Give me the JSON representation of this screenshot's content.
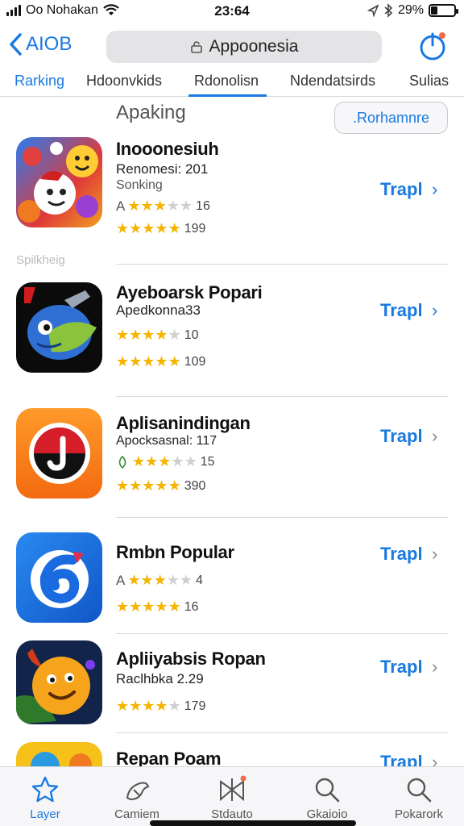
{
  "status": {
    "carrier": "Oo Nohakan",
    "time": "23:64",
    "battery_pct": "29%",
    "battery_level": 0.29
  },
  "nav": {
    "back_label": "AIOB",
    "search_text": "Appoonesia"
  },
  "tabs": [
    {
      "label": "Rarking"
    },
    {
      "label": "Hdoonvkids"
    },
    {
      "label": "Rdonolisn"
    },
    {
      "label": "Ndendatsirds"
    },
    {
      "label": "Sulias"
    }
  ],
  "section": {
    "title": "Apaking",
    "button": ".Rorhamnre",
    "side_label": "Spilkheig"
  },
  "apps": [
    {
      "name": "Inooonesiuh",
      "sub": "Renomesi: 201",
      "sub2": "Sonking",
      "r1_prefix": "A",
      "r1_stars": 3,
      "r1_count": "16",
      "r2_stars": 5,
      "r2_count": "199",
      "get": "Trapl",
      "icon": "emoji-ball-icon"
    },
    {
      "name": "Ayeboarsk Popari",
      "sub": "Apedkonna33",
      "r1_prefix": "",
      "r1_stars": 4,
      "r1_count": "10",
      "r2_stars": 5,
      "r2_count": "109",
      "get": "Trapl",
      "icon": "blue-bird-icon"
    },
    {
      "name": "Aplisanindingan",
      "sub": "Apocksasnal: 117",
      "r1_prefix": "leaf",
      "r1_stars": 3,
      "r1_count": "15",
      "r2_stars": 5,
      "r2_count": "390",
      "get": "Trapl",
      "icon": "red-j-icon"
    },
    {
      "name": "Rmbn Popular",
      "r1_prefix": "A",
      "r1_stars": 3,
      "r1_count": "4",
      "r2_stars": 5,
      "r2_count": "16",
      "get": "Trapl",
      "icon": "blue-swirl-icon"
    },
    {
      "name": "Apliiyabsis Ropan",
      "sub": "Raclhbka 2.29",
      "r2_stars": 4,
      "r2_count": "179",
      "get": "Trapl",
      "icon": "orange-face-icon"
    },
    {
      "name": "Repan Poam",
      "get": "Trapl",
      "icon": "yellow-partial-icon"
    }
  ],
  "tabbar": [
    {
      "label": "Layer",
      "icon": "star-icon"
    },
    {
      "label": "Camiem",
      "icon": "bird-outline-icon"
    },
    {
      "label": "Stdauto",
      "icon": "bowtie-icon"
    },
    {
      "label": "Gkaioio",
      "icon": "search-icon"
    },
    {
      "label": "Pokarork",
      "icon": "search-icon"
    }
  ],
  "colors": {
    "accent": "#1a7ae0",
    "star": "#f4b400"
  }
}
